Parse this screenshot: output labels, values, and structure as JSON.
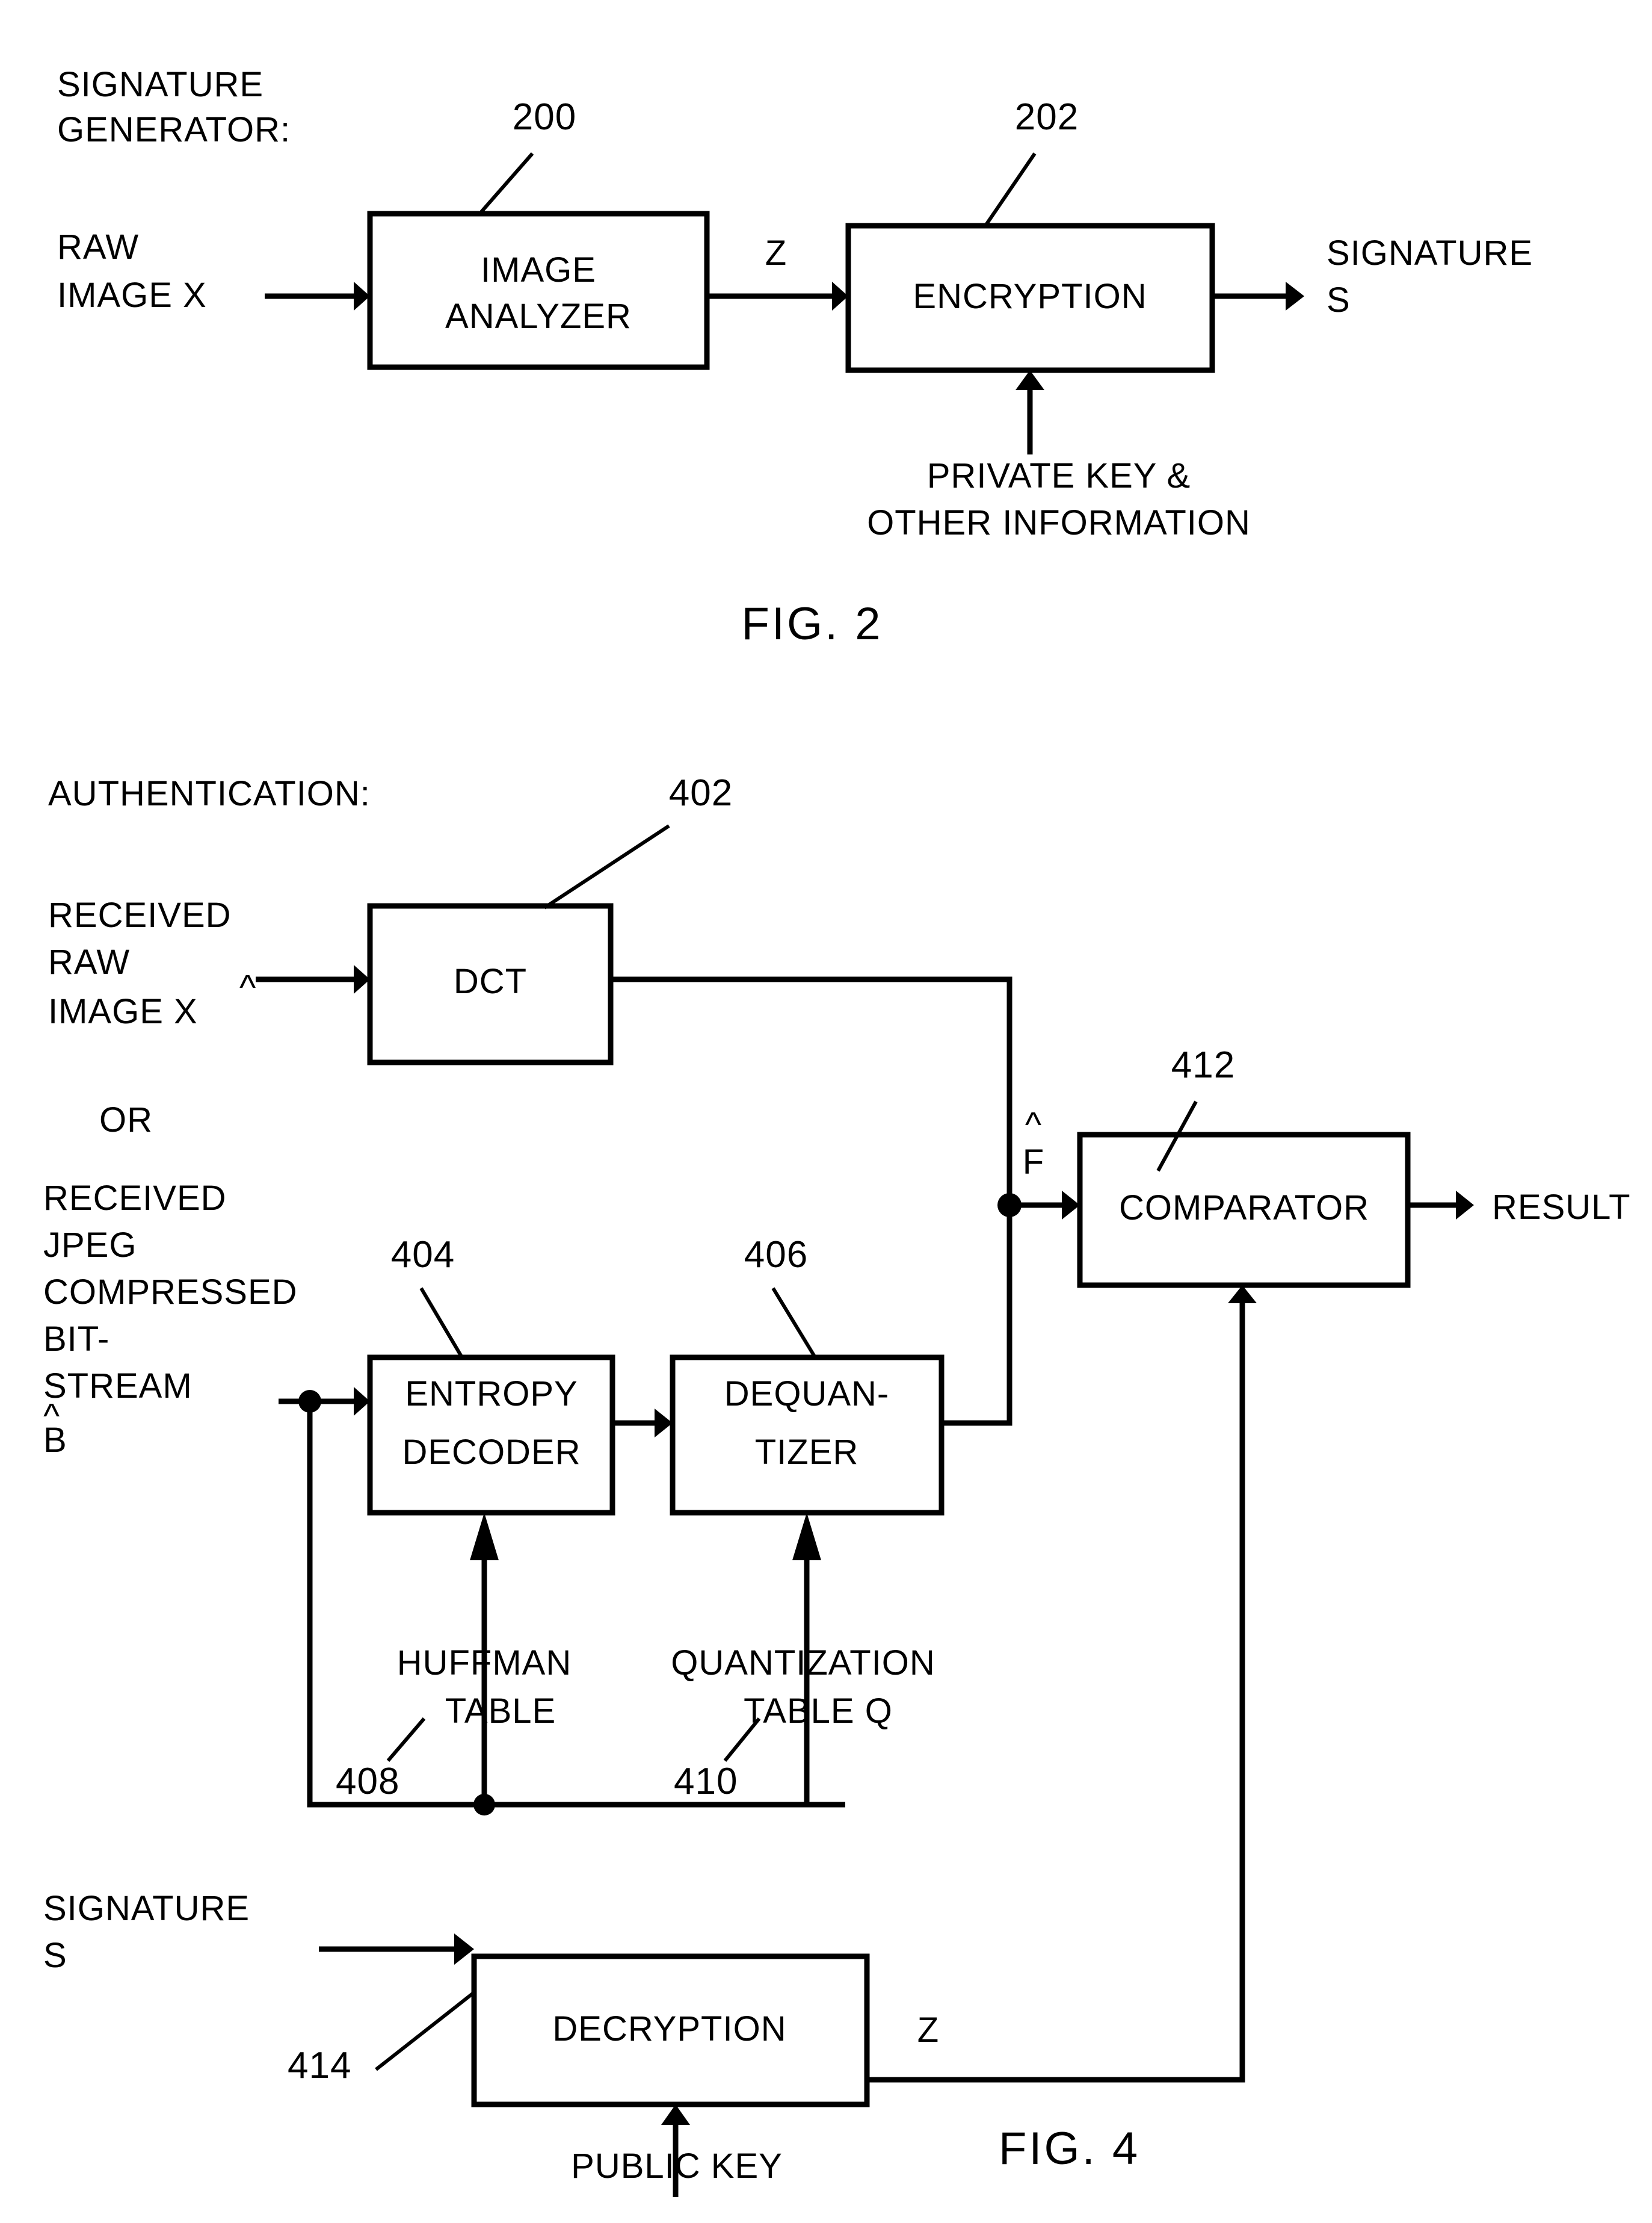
{
  "page": {
    "background": "#ffffff",
    "ink": "#000000"
  },
  "figures": [
    {
      "id": "fig2",
      "caption": "FIG. 2",
      "heading_line1": "SIGNATURE",
      "heading_line2": "GENERATOR:",
      "blocks": [
        {
          "id": "image-analyzer",
          "ref": "200",
          "line1": "IMAGE",
          "line2": "ANALYZER"
        },
        {
          "id": "encryption",
          "ref": "202",
          "line1": "ENCRYPTION",
          "line2": ""
        }
      ],
      "labels": {
        "input_line1": "RAW",
        "input_line2": "IMAGE X",
        "signal_z": "Z",
        "output_line1": "SIGNATURE",
        "output_line2": "S",
        "key_line1": "PRIVATE KEY &",
        "key_line2": "OTHER INFORMATION"
      }
    },
    {
      "id": "fig4",
      "caption": "FIG. 4",
      "heading_line1": "AUTHENTICATION:",
      "blocks": [
        {
          "id": "dct",
          "ref": "402",
          "line1": "DCT",
          "line2": ""
        },
        {
          "id": "entropy-decoder",
          "ref": "404",
          "line1": "ENTROPY",
          "line2": "DECODER"
        },
        {
          "id": "dequantizer",
          "ref": "406",
          "line1": "DEQUAN-",
          "line2": "TIZER"
        },
        {
          "id": "comparator",
          "ref": "412",
          "line1": "COMPARATOR",
          "line2": ""
        },
        {
          "id": "decryption",
          "ref": "414",
          "line1": "DECRYPTION",
          "line2": ""
        }
      ],
      "labels": {
        "raw_input_line1": "RECEIVED",
        "raw_input_line2": "RAW",
        "raw_input_line3": "IMAGE X",
        "raw_input_hat": "^",
        "or": "OR",
        "jpeg_input_line1": "RECEIVED",
        "jpeg_input_line2": "JPEG",
        "jpeg_input_line3": "COMPRESSED",
        "jpeg_input_line4": "BIT-",
        "jpeg_input_line5": "STREAM",
        "jpeg_input_line6": "B",
        "jpeg_input_hat": "^",
        "f_hat_letter": "F",
        "f_hat_accent": "^",
        "result": "RESULT",
        "huffman_line1": "HUFFMAN",
        "huffman_line2": "TABLE",
        "huffman_ref": "408",
        "quant_line1": "QUANTIZATION",
        "quant_line2": "TABLE Q",
        "quant_ref": "410",
        "signature_line1": "SIGNATURE",
        "signature_line2": "S",
        "signal_z": "Z",
        "public_key": "PUBLIC KEY"
      }
    }
  ]
}
